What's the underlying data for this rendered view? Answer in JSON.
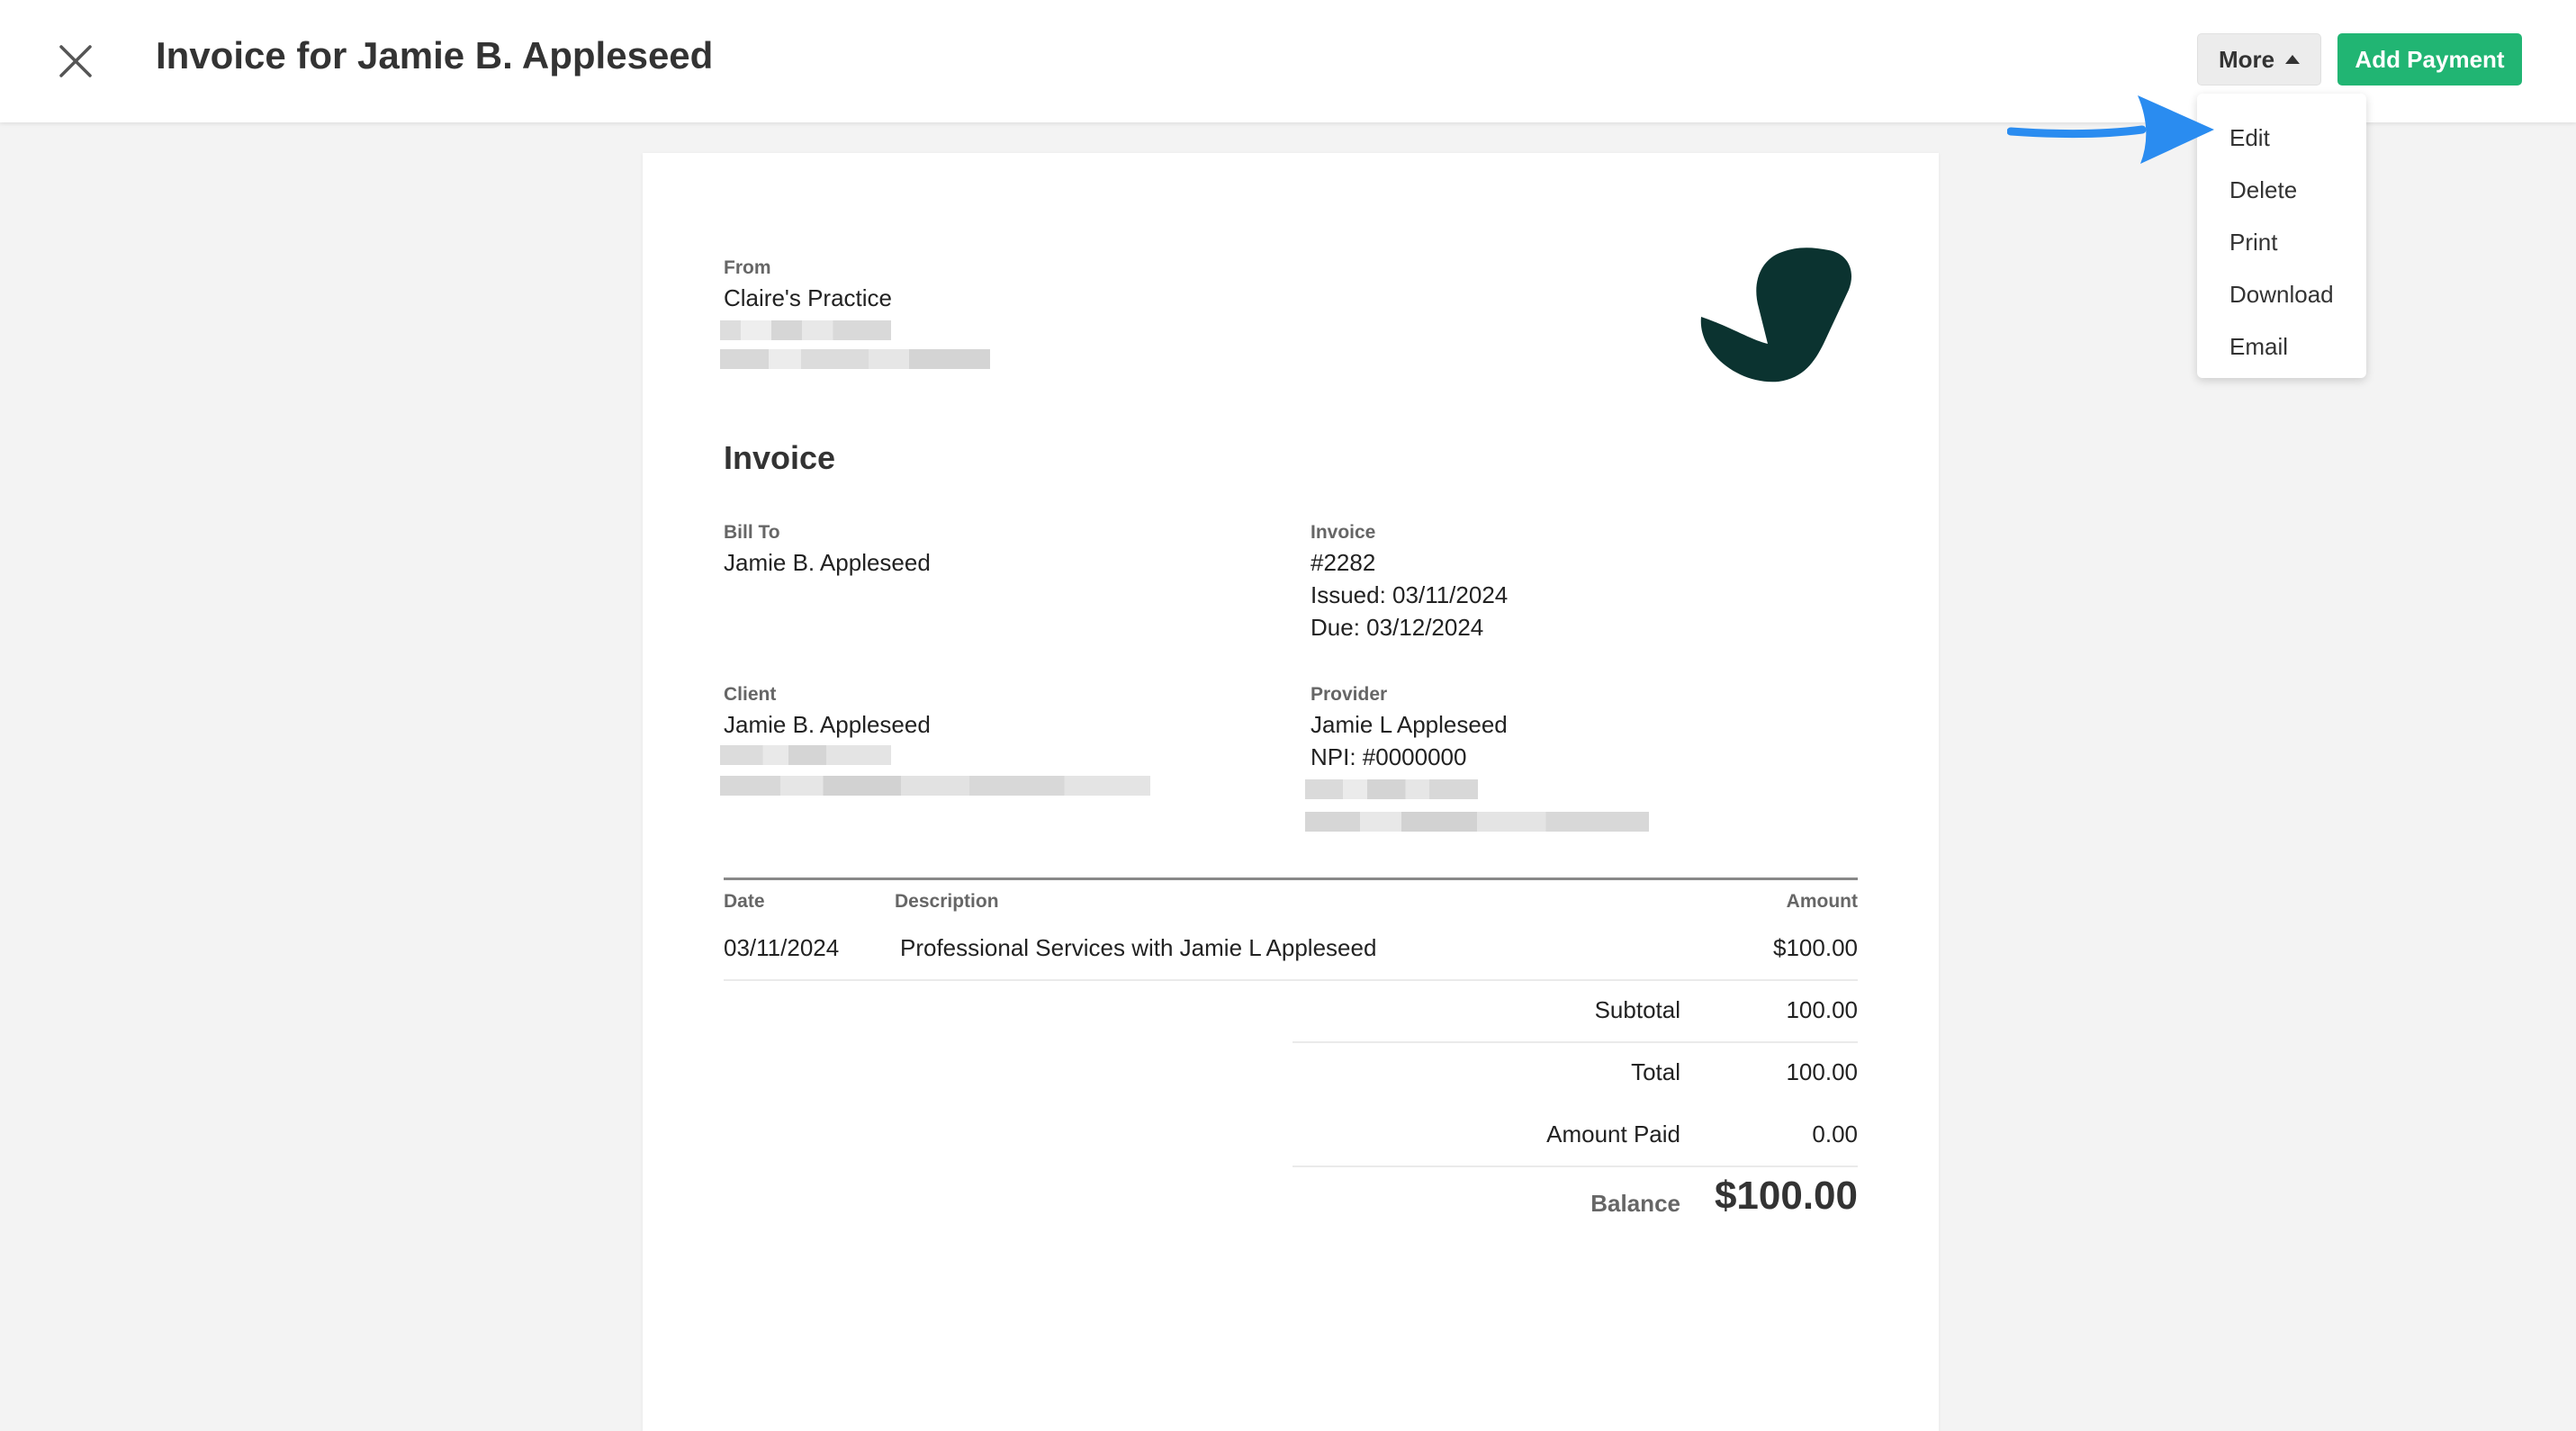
{
  "header": {
    "title": "Invoice for Jamie B. Appleseed",
    "more_label": "More",
    "add_payment_label": "Add Payment",
    "close_icon": "close-icon"
  },
  "dropdown": {
    "items": [
      {
        "label": "Edit"
      },
      {
        "label": "Delete"
      },
      {
        "label": "Print"
      },
      {
        "label": "Download"
      },
      {
        "label": "Email"
      }
    ]
  },
  "invoice": {
    "from_label": "From",
    "from_name": "Claire's Practice",
    "heading": "Invoice",
    "bill_to_label": "Bill To",
    "bill_to_name": "Jamie B. Appleseed",
    "invoice_label": "Invoice",
    "invoice_number": "#2282",
    "issued": "Issued: 03/11/2024",
    "due": "Due: 03/12/2024",
    "client_label": "Client",
    "client_name": "Jamie B. Appleseed",
    "provider_label": "Provider",
    "provider_name": "Jamie L Appleseed",
    "provider_npi": "NPI: #0000000",
    "table": {
      "headers": {
        "date": "Date",
        "description": "Description",
        "amount": "Amount"
      },
      "rows": [
        {
          "date": "03/11/2024",
          "description": "Professional Services with Jamie L Appleseed",
          "amount": "$100.00"
        }
      ]
    },
    "summary": {
      "subtotal_label": "Subtotal",
      "subtotal_value": "100.00",
      "total_label": "Total",
      "total_value": "100.00",
      "paid_label": "Amount Paid",
      "paid_value": "0.00",
      "balance_label": "Balance",
      "balance_value": "$100.00"
    }
  },
  "colors": {
    "accent_green": "#21b573",
    "logo_dark": "#0b3330",
    "annotation_arrow": "#2a8cf0"
  }
}
